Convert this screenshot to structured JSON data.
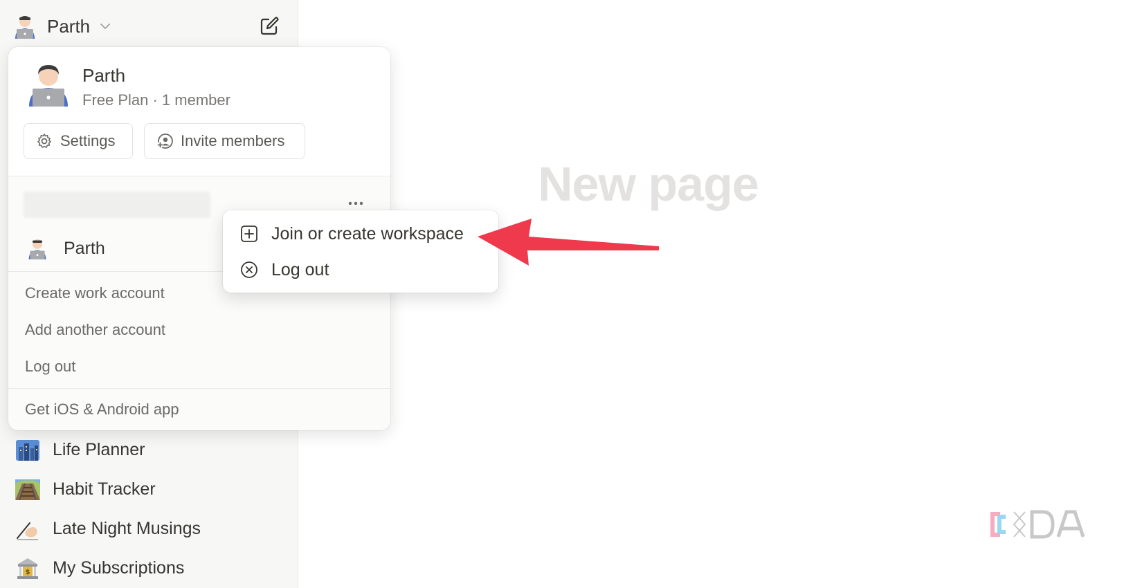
{
  "sidebar": {
    "workspace_name": "Parth",
    "items": [
      {
        "label": "Life Planner",
        "icon": "cityscape-icon"
      },
      {
        "label": "Habit Tracker",
        "icon": "railway-track-icon"
      },
      {
        "label": "Late Night Musings",
        "icon": "writing-hand-icon"
      },
      {
        "label": "My Subscriptions",
        "icon": "bank-icon"
      }
    ]
  },
  "main": {
    "title": "New page"
  },
  "workspace_popup": {
    "name": "Parth",
    "plan": "Free Plan · 1 member",
    "settings_label": "Settings",
    "invite_label": "Invite members",
    "account_name": "Parth",
    "links": {
      "create_work": "Create work account",
      "add_account": "Add another account",
      "log_out": "Log out",
      "get_app": "Get iOS & Android app"
    }
  },
  "context_menu": {
    "items": [
      {
        "label": "Join or create workspace",
        "icon": "plus-square-icon"
      },
      {
        "label": "Log out",
        "icon": "close-circle-icon"
      }
    ]
  },
  "colors": {
    "arrow": "#ef3a4d",
    "sidebar_bg": "#f7f7f5",
    "title_placeholder": "#e3e2e0"
  }
}
